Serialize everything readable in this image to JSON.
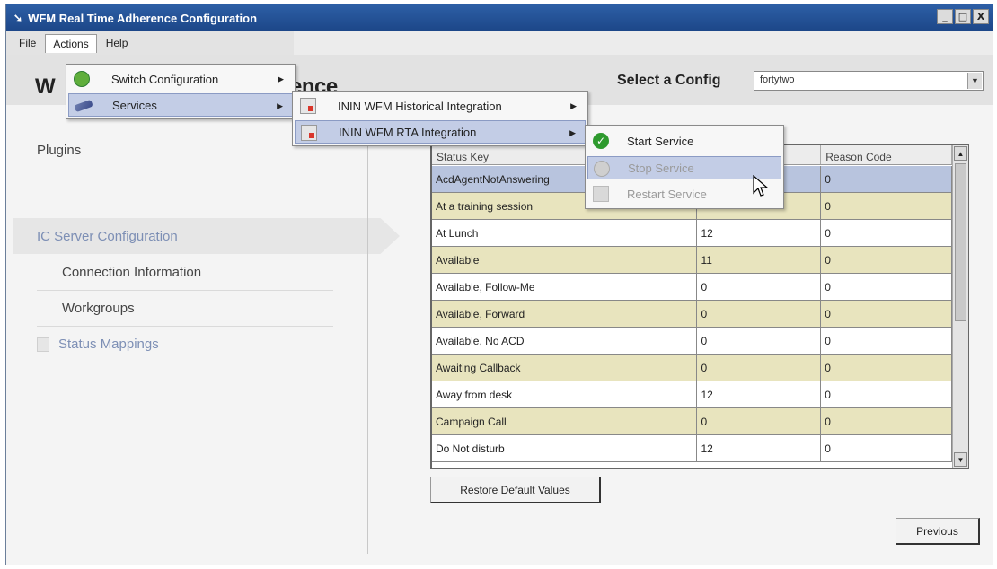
{
  "window": {
    "title": "WFM Real Time Adherence Configuration",
    "controls": [
      "_",
      "□",
      "X"
    ]
  },
  "menubar": {
    "file": "File",
    "actions": "Actions",
    "help": "Help"
  },
  "header": {
    "title_start": "W",
    "title_end": "ence",
    "select_label": "Select a Config",
    "config_value": "fortytwo"
  },
  "nav": {
    "plugins": "Plugins",
    "ic_server": "IC Server Configuration",
    "connection": "Connection Information",
    "workgroups": "Workgroups",
    "status_mappings": "Status Mappings"
  },
  "grid": {
    "columns": [
      "Status Key",
      "",
      "Reason Code"
    ],
    "rows": [
      [
        "AcdAgentNotAnswering",
        "",
        "0"
      ],
      [
        "At a training session",
        "",
        "0"
      ],
      [
        "At Lunch",
        "12",
        "0"
      ],
      [
        "Available",
        "11",
        "0"
      ],
      [
        "Available, Follow-Me",
        "0",
        "0"
      ],
      [
        "Available, Forward",
        "0",
        "0"
      ],
      [
        "Available, No ACD",
        "0",
        "0"
      ],
      [
        "Awaiting Callback",
        "0",
        "0"
      ],
      [
        "Away from desk",
        "12",
        "0"
      ],
      [
        "Campaign Call",
        "0",
        "0"
      ],
      [
        "Do Not disturb",
        "12",
        "0"
      ]
    ]
  },
  "buttons": {
    "restore": "Restore Default Values",
    "previous": "Previous"
  },
  "actions_menu": {
    "switch": "Switch Configuration",
    "services": "Services"
  },
  "services_menu": {
    "historical": "ININ WFM Historical Integration",
    "rta": "ININ WFM RTA Integration"
  },
  "rta_menu": {
    "start": "Start Service",
    "stop": "Stop Service",
    "restart": "Restart Service"
  },
  "icons": {
    "switch": "switch-config-icon",
    "services": "services-icon",
    "integration": "integration-icon",
    "start": "green-check-icon",
    "stop": "stop-icon",
    "restart": "restart-icon",
    "submenu": "submenu-arrow-icon"
  },
  "colors": {
    "title_bar": "#1c4688",
    "row_alt": "#e8e4be",
    "row_selected": "#b8c4de",
    "menu_highlight": "#c3cde6"
  }
}
